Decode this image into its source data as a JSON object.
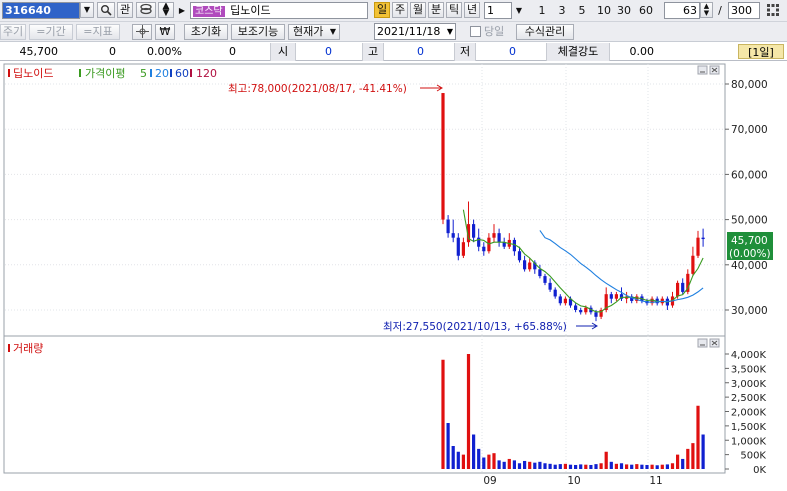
{
  "toolbar": {
    "code": "316640",
    "lookup_icon": "magnifier-icon",
    "gwan": "관",
    "stock_tag": "코스닥",
    "stock_name": "딥노이드",
    "period_buttons": [
      "일",
      "주",
      "월",
      "분",
      "틱",
      "년"
    ],
    "active_period": "일",
    "unit_value": "1",
    "minute_buttons": [
      "1",
      "3",
      "5",
      "10",
      "30",
      "60"
    ],
    "count": "63",
    "slash": "/",
    "total": "300"
  },
  "toolbar2": {
    "cycle": "주기",
    "period": "=기간",
    "indicator": "=지표",
    "reset": "초기화",
    "aux": "보조기능",
    "current_price": "현재가",
    "date": "2021/11/18",
    "same_day": "당일",
    "formula": "수식관리"
  },
  "quote": {
    "price": "45,700",
    "change": "0",
    "rate": "0.00%",
    "volume": "0",
    "open_label": "시",
    "open": "0",
    "high_label": "고",
    "high": "0",
    "low_label": "저",
    "low": "0",
    "strength_label": "체결강도",
    "strength": "0.00",
    "period_tag": "[1일]"
  },
  "price_panel": {
    "legend_stock": "딥노이드",
    "legend_ma": "가격이평",
    "ma_periods": [
      "5",
      "20",
      "60",
      "120"
    ],
    "high_annotation": "최고:78,000(2021/08/17, -41.41%)",
    "low_annotation": "최저:27,550(2021/10/13, +65.88%)",
    "last_price_label": "45,700",
    "last_change_label": "(0.00%)",
    "colors": {
      "up": "#e01010",
      "down": "#1020d0",
      "ma5": "#3a9a20",
      "ma20": "#2080e0",
      "ma60": "#1040c0",
      "ma120": "#b01040"
    }
  },
  "volume_panel": {
    "legend": "거래량"
  },
  "chart_data": [
    {
      "type": "candlestick",
      "title": "딥노이드",
      "ylim": [
        25000,
        85000
      ],
      "y_ticks": [
        "80,000",
        "70,000",
        "60,000",
        "50,000",
        "40,000",
        "30,000"
      ],
      "x_ticks": [
        "09",
        "10",
        "11"
      ],
      "candles": [
        {
          "o": 50000,
          "c": 78000,
          "h": 78000,
          "l": 49000
        },
        {
          "o": 50000,
          "c": 47000,
          "h": 51000,
          "l": 46000
        },
        {
          "o": 47000,
          "c": 46000,
          "h": 50000,
          "l": 45000
        },
        {
          "o": 46000,
          "c": 42000,
          "h": 47000,
          "l": 41000
        },
        {
          "o": 42000,
          "c": 45000,
          "h": 46000,
          "l": 41500
        },
        {
          "o": 45000,
          "c": 49000,
          "h": 54000,
          "l": 44000
        },
        {
          "o": 49000,
          "c": 46000,
          "h": 50000,
          "l": 45000
        },
        {
          "o": 46000,
          "c": 44000,
          "h": 48000,
          "l": 43000
        },
        {
          "o": 44000,
          "c": 43000,
          "h": 45000,
          "l": 42000
        },
        {
          "o": 43000,
          "c": 46000,
          "h": 47000,
          "l": 42500
        },
        {
          "o": 46000,
          "c": 47000,
          "h": 49000,
          "l": 45000
        },
        {
          "o": 47000,
          "c": 45000,
          "h": 48000,
          "l": 44000
        },
        {
          "o": 45000,
          "c": 44000,
          "h": 46000,
          "l": 43500
        },
        {
          "o": 44000,
          "c": 45500,
          "h": 47000,
          "l": 43500
        },
        {
          "o": 45500,
          "c": 43000,
          "h": 46000,
          "l": 42000
        },
        {
          "o": 43000,
          "c": 41000,
          "h": 44000,
          "l": 40500
        },
        {
          "o": 41000,
          "c": 39000,
          "h": 42000,
          "l": 38500
        },
        {
          "o": 39000,
          "c": 40500,
          "h": 41500,
          "l": 38500
        },
        {
          "o": 40500,
          "c": 39000,
          "h": 41000,
          "l": 38000
        },
        {
          "o": 39000,
          "c": 37500,
          "h": 40000,
          "l": 37000
        },
        {
          "o": 37500,
          "c": 36000,
          "h": 38000,
          "l": 35500
        },
        {
          "o": 36000,
          "c": 34500,
          "h": 37000,
          "l": 34000
        },
        {
          "o": 34500,
          "c": 33000,
          "h": 35000,
          "l": 32500
        },
        {
          "o": 33000,
          "c": 31500,
          "h": 33500,
          "l": 31000
        },
        {
          "o": 31500,
          "c": 32500,
          "h": 33000,
          "l": 31000
        },
        {
          "o": 32500,
          "c": 31000,
          "h": 33000,
          "l": 30500
        },
        {
          "o": 31000,
          "c": 30000,
          "h": 31500,
          "l": 29500
        },
        {
          "o": 30000,
          "c": 29500,
          "h": 30500,
          "l": 29000
        },
        {
          "o": 29500,
          "c": 30500,
          "h": 31000,
          "l": 29000
        },
        {
          "o": 30500,
          "c": 29500,
          "h": 31000,
          "l": 29000
        },
        {
          "o": 29500,
          "c": 28500,
          "h": 30000,
          "l": 27550
        },
        {
          "o": 28500,
          "c": 30000,
          "h": 30500,
          "l": 28000
        },
        {
          "o": 30000,
          "c": 33500,
          "h": 35000,
          "l": 29500
        },
        {
          "o": 33500,
          "c": 32500,
          "h": 34000,
          "l": 31500
        },
        {
          "o": 32500,
          "c": 33500,
          "h": 34000,
          "l": 32000
        },
        {
          "o": 33500,
          "c": 32500,
          "h": 35000,
          "l": 32000
        },
        {
          "o": 32500,
          "c": 33000,
          "h": 34000,
          "l": 31500
        },
        {
          "o": 33000,
          "c": 32000,
          "h": 33500,
          "l": 31500
        },
        {
          "o": 32000,
          "c": 33000,
          "h": 33500,
          "l": 31500
        },
        {
          "o": 33000,
          "c": 32000,
          "h": 33500,
          "l": 31500
        },
        {
          "o": 32000,
          "c": 31500,
          "h": 32500,
          "l": 31000
        },
        {
          "o": 31500,
          "c": 32500,
          "h": 33000,
          "l": 31000
        },
        {
          "o": 32500,
          "c": 31500,
          "h": 33000,
          "l": 31000
        },
        {
          "o": 31500,
          "c": 32500,
          "h": 33000,
          "l": 31000
        },
        {
          "o": 32500,
          "c": 31000,
          "h": 33000,
          "l": 30000
        },
        {
          "o": 31000,
          "c": 33000,
          "h": 34000,
          "l": 30500
        },
        {
          "o": 33000,
          "c": 36000,
          "h": 36500,
          "l": 32500
        },
        {
          "o": 36000,
          "c": 34000,
          "h": 37000,
          "l": 33500
        },
        {
          "o": 34000,
          "c": 38000,
          "h": 39000,
          "l": 33500
        },
        {
          "o": 38000,
          "c": 42000,
          "h": 44000,
          "l": 37500
        },
        {
          "o": 42000,
          "c": 46000,
          "h": 47500,
          "l": 41500
        },
        {
          "o": 46000,
          "c": 45700,
          "h": 48000,
          "l": 44000
        }
      ],
      "ma5": [
        null,
        null,
        null,
        null,
        52200,
        45800,
        45200,
        45600,
        45400,
        44600,
        45000,
        45000,
        45000,
        44700,
        44500,
        43800,
        42400,
        41500,
        40300,
        39200,
        38500,
        37500,
        36200,
        34900,
        33700,
        32500,
        31600,
        30900,
        30700,
        30100,
        29600,
        29600,
        30500,
        31000,
        31800,
        32800,
        32800,
        32800,
        32700,
        32500,
        32100,
        32200,
        31900,
        31900,
        31800,
        32100,
        33100,
        33400,
        34800,
        37600,
        39200,
        41500
      ],
      "ma20": [
        null,
        null,
        null,
        null,
        null,
        null,
        null,
        null,
        null,
        null,
        null,
        null,
        null,
        null,
        null,
        null,
        null,
        null,
        null,
        47600,
        46000,
        45500,
        44700,
        43800,
        43100,
        42300,
        41300,
        40300,
        39500,
        38600,
        37600,
        36700,
        35900,
        35200,
        34500,
        33900,
        33200,
        32700,
        32300,
        32000,
        31800,
        31700,
        31800,
        31900,
        31900,
        32000,
        32300,
        32500,
        32800,
        33300,
        34000,
        34900
      ]
    },
    {
      "type": "bar",
      "title": "거래량",
      "ylim": [
        0,
        4200
      ],
      "y_ticks": [
        "4,000K",
        "3,500K",
        "3,000K",
        "2,500K",
        "2,000K",
        "1,500K",
        "1,000K",
        "500K",
        "0K"
      ],
      "values": [
        3800,
        1600,
        800,
        600,
        500,
        4000,
        1200,
        700,
        400,
        500,
        550,
        300,
        250,
        350,
        300,
        200,
        280,
        250,
        220,
        250,
        200,
        180,
        150,
        170,
        180,
        150,
        140,
        160,
        150,
        140,
        170,
        200,
        600,
        250,
        180,
        200,
        160,
        150,
        170,
        150,
        140,
        150,
        130,
        150,
        160,
        200,
        500,
        350,
        700,
        900,
        2200,
        1200
      ],
      "up": [
        true,
        false,
        false,
        false,
        true,
        true,
        false,
        false,
        false,
        true,
        true,
        false,
        false,
        true,
        false,
        false,
        false,
        true,
        false,
        false,
        false,
        false,
        false,
        false,
        true,
        false,
        false,
        false,
        true,
        false,
        false,
        true,
        true,
        false,
        true,
        false,
        true,
        false,
        true,
        false,
        false,
        true,
        false,
        true,
        false,
        true,
        true,
        false,
        true,
        true,
        true,
        false
      ]
    }
  ]
}
